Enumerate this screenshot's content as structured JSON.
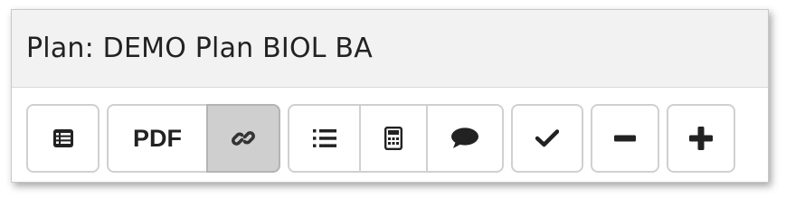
{
  "header": {
    "title": "Plan: DEMO Plan BIOL BA"
  },
  "toolbar": {
    "table_view_icon": "list-alt-icon",
    "pdf_label": "PDF",
    "link_icon": "link-icon",
    "list_icon": "list-icon",
    "calculator_icon": "calculator-icon",
    "comment_icon": "comment-icon",
    "check_icon": "check-icon",
    "minus_icon": "minus-icon",
    "plus_icon": "plus-icon",
    "active_button": "link",
    "active_color": "#cfcfcf"
  }
}
